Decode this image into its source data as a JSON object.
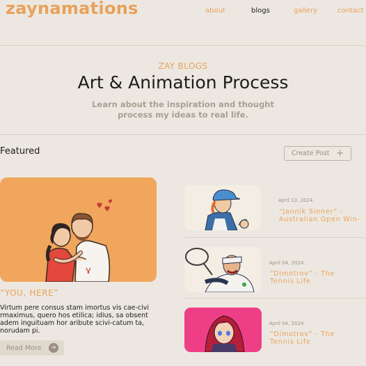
{
  "nav": {
    "brand": "zaynamations",
    "links": [
      "about",
      "blogs",
      "gallery",
      "contact"
    ]
  },
  "hero": {
    "kicker": "ZAY BLOGS",
    "title": "Art & Animation Process",
    "subtitle_line1": "Learn about the inspiration and thought",
    "subtitle_line2": "process my ideas to real life."
  },
  "featured": {
    "label": "Featured",
    "create_label": "Create Post",
    "post_title": "“YOU, HERE”",
    "body": "Virtum pere consus stam imortus vis cae-civi rmaximus, quero hos etilica; idius, sa obsent adem inguituam hor aribute scivi-catum ta, norudam pi.",
    "read_more": "Read More"
  },
  "posts": [
    {
      "date": "April 13, 2024",
      "title": "“Jannik Sinner” - Australian Open Win-"
    },
    {
      "date": "April 04, 2024",
      "title": "“Dimotrov” - The Tennis Life"
    },
    {
      "date": "April 04, 2024",
      "title": "“Dimotrov” - The Tennis Life"
    }
  ],
  "colors": {
    "background": "#ece8e1",
    "accent": "#e9a15a",
    "muted": "#9b8f82",
    "thumb_pink": "#ee3f86"
  }
}
